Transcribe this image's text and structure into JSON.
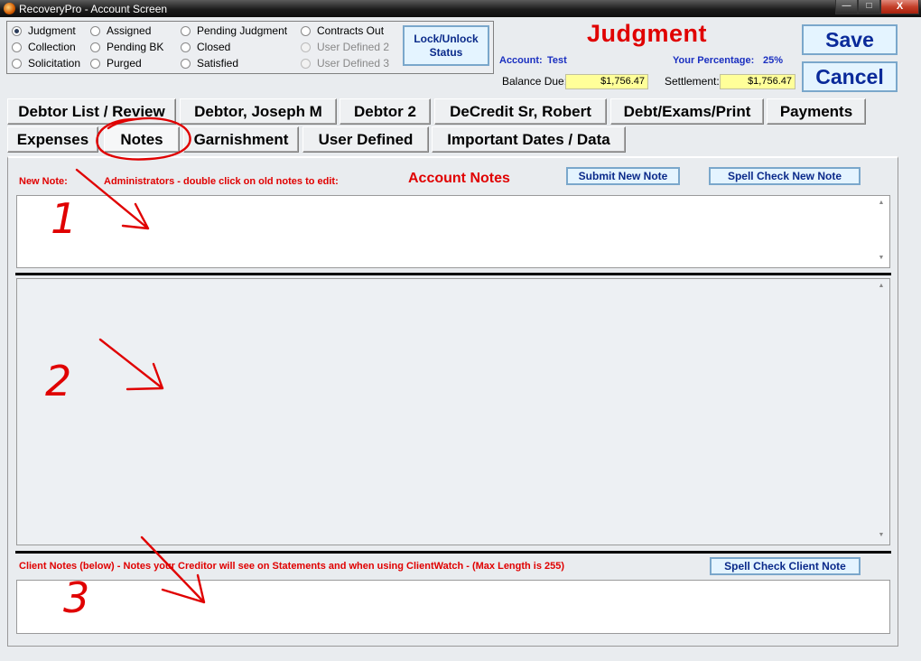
{
  "window": {
    "title": "RecoveryPro - Account Screen",
    "buttons": {
      "minimize": "—",
      "maximize": "□",
      "close": "X"
    }
  },
  "status": {
    "options": [
      {
        "label": "Judgment",
        "checked": true,
        "disabled": false
      },
      {
        "label": "Collection",
        "checked": false,
        "disabled": false
      },
      {
        "label": "Solicitation",
        "checked": false,
        "disabled": false
      },
      {
        "label": "Assigned",
        "checked": false,
        "disabled": false
      },
      {
        "label": "Pending BK",
        "checked": false,
        "disabled": false
      },
      {
        "label": "Purged",
        "checked": false,
        "disabled": false
      },
      {
        "label": "Pending Judgment",
        "checked": false,
        "disabled": false
      },
      {
        "label": "Closed",
        "checked": false,
        "disabled": false
      },
      {
        "label": "Satisfied",
        "checked": false,
        "disabled": false
      },
      {
        "label": "Contracts Out",
        "checked": false,
        "disabled": false
      },
      {
        "label": "User Defined 2",
        "checked": false,
        "disabled": true
      },
      {
        "label": "User Defined 3",
        "checked": false,
        "disabled": true
      }
    ],
    "lock_button": "Lock/Unlock Status"
  },
  "header": {
    "title": "Judgment",
    "account_label": "Account:",
    "account_value": "Test",
    "percentage_label": "Your Percentage:",
    "percentage_value": "25%",
    "balance_label": "Balance Due:",
    "balance_value": "$1,756.47",
    "settlement_label": "Settlement:",
    "settlement_value": "$1,756.47",
    "save_label": "Save",
    "cancel_label": "Cancel"
  },
  "tabs": {
    "row1": [
      "Debtor List / Review",
      "Debtor, Joseph M",
      "Debtor 2",
      "DeCredit Sr, Robert",
      "Debt/Exams/Print",
      "Payments"
    ],
    "row2": [
      "Expenses",
      "Notes",
      "Garnishment",
      "User Defined",
      "Important Dates / Data"
    ],
    "active": "Notes"
  },
  "notes": {
    "new_note_label": "New Note:",
    "admin_hint": "Administrators - double click on old notes to edit:",
    "section_title": "Account Notes",
    "submit_button": "Submit New Note",
    "spell_check_button": "Spell Check New Note",
    "new_note_value": "",
    "old_notes_value": "",
    "client_notes_label": "Client Notes (below) - Notes your Creditor will see on Statements and when using ClientWatch - (Max Length is 255)",
    "client_spell_check_button": "Spell Check Client Note",
    "client_note_value": ""
  },
  "annotations": {
    "marks": [
      "1",
      "2",
      "3"
    ],
    "color": "#e00000"
  }
}
